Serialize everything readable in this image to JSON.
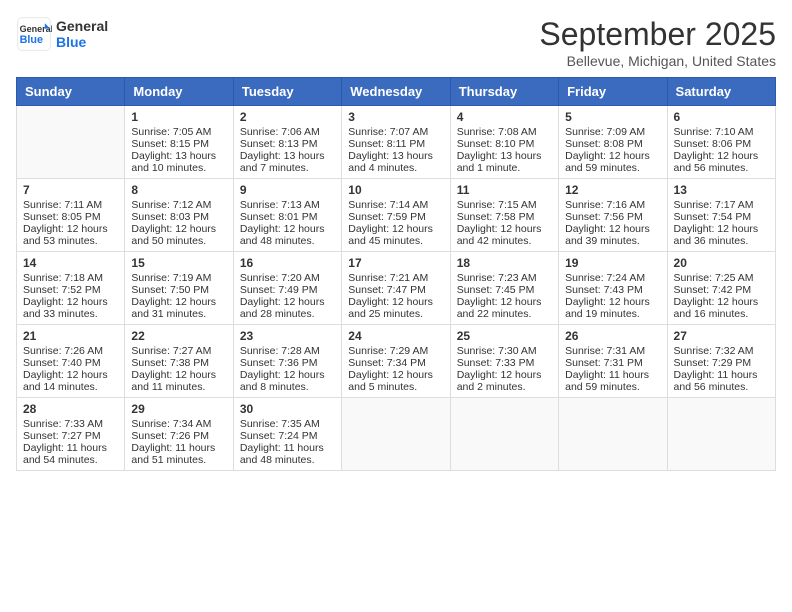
{
  "logo": {
    "line1": "General",
    "line2": "Blue"
  },
  "title": "September 2025",
  "subtitle": "Bellevue, Michigan, United States",
  "weekdays": [
    "Sunday",
    "Monday",
    "Tuesday",
    "Wednesday",
    "Thursday",
    "Friday",
    "Saturday"
  ],
  "weeks": [
    [
      {
        "day": "",
        "lines": []
      },
      {
        "day": "1",
        "lines": [
          "Sunrise: 7:05 AM",
          "Sunset: 8:15 PM",
          "Daylight: 13 hours",
          "and 10 minutes."
        ]
      },
      {
        "day": "2",
        "lines": [
          "Sunrise: 7:06 AM",
          "Sunset: 8:13 PM",
          "Daylight: 13 hours",
          "and 7 minutes."
        ]
      },
      {
        "day": "3",
        "lines": [
          "Sunrise: 7:07 AM",
          "Sunset: 8:11 PM",
          "Daylight: 13 hours",
          "and 4 minutes."
        ]
      },
      {
        "day": "4",
        "lines": [
          "Sunrise: 7:08 AM",
          "Sunset: 8:10 PM",
          "Daylight: 13 hours",
          "and 1 minute."
        ]
      },
      {
        "day": "5",
        "lines": [
          "Sunrise: 7:09 AM",
          "Sunset: 8:08 PM",
          "Daylight: 12 hours",
          "and 59 minutes."
        ]
      },
      {
        "day": "6",
        "lines": [
          "Sunrise: 7:10 AM",
          "Sunset: 8:06 PM",
          "Daylight: 12 hours",
          "and 56 minutes."
        ]
      }
    ],
    [
      {
        "day": "7",
        "lines": [
          "Sunrise: 7:11 AM",
          "Sunset: 8:05 PM",
          "Daylight: 12 hours",
          "and 53 minutes."
        ]
      },
      {
        "day": "8",
        "lines": [
          "Sunrise: 7:12 AM",
          "Sunset: 8:03 PM",
          "Daylight: 12 hours",
          "and 50 minutes."
        ]
      },
      {
        "day": "9",
        "lines": [
          "Sunrise: 7:13 AM",
          "Sunset: 8:01 PM",
          "Daylight: 12 hours",
          "and 48 minutes."
        ]
      },
      {
        "day": "10",
        "lines": [
          "Sunrise: 7:14 AM",
          "Sunset: 7:59 PM",
          "Daylight: 12 hours",
          "and 45 minutes."
        ]
      },
      {
        "day": "11",
        "lines": [
          "Sunrise: 7:15 AM",
          "Sunset: 7:58 PM",
          "Daylight: 12 hours",
          "and 42 minutes."
        ]
      },
      {
        "day": "12",
        "lines": [
          "Sunrise: 7:16 AM",
          "Sunset: 7:56 PM",
          "Daylight: 12 hours",
          "and 39 minutes."
        ]
      },
      {
        "day": "13",
        "lines": [
          "Sunrise: 7:17 AM",
          "Sunset: 7:54 PM",
          "Daylight: 12 hours",
          "and 36 minutes."
        ]
      }
    ],
    [
      {
        "day": "14",
        "lines": [
          "Sunrise: 7:18 AM",
          "Sunset: 7:52 PM",
          "Daylight: 12 hours",
          "and 33 minutes."
        ]
      },
      {
        "day": "15",
        "lines": [
          "Sunrise: 7:19 AM",
          "Sunset: 7:50 PM",
          "Daylight: 12 hours",
          "and 31 minutes."
        ]
      },
      {
        "day": "16",
        "lines": [
          "Sunrise: 7:20 AM",
          "Sunset: 7:49 PM",
          "Daylight: 12 hours",
          "and 28 minutes."
        ]
      },
      {
        "day": "17",
        "lines": [
          "Sunrise: 7:21 AM",
          "Sunset: 7:47 PM",
          "Daylight: 12 hours",
          "and 25 minutes."
        ]
      },
      {
        "day": "18",
        "lines": [
          "Sunrise: 7:23 AM",
          "Sunset: 7:45 PM",
          "Daylight: 12 hours",
          "and 22 minutes."
        ]
      },
      {
        "day": "19",
        "lines": [
          "Sunrise: 7:24 AM",
          "Sunset: 7:43 PM",
          "Daylight: 12 hours",
          "and 19 minutes."
        ]
      },
      {
        "day": "20",
        "lines": [
          "Sunrise: 7:25 AM",
          "Sunset: 7:42 PM",
          "Daylight: 12 hours",
          "and 16 minutes."
        ]
      }
    ],
    [
      {
        "day": "21",
        "lines": [
          "Sunrise: 7:26 AM",
          "Sunset: 7:40 PM",
          "Daylight: 12 hours",
          "and 14 minutes."
        ]
      },
      {
        "day": "22",
        "lines": [
          "Sunrise: 7:27 AM",
          "Sunset: 7:38 PM",
          "Daylight: 12 hours",
          "and 11 minutes."
        ]
      },
      {
        "day": "23",
        "lines": [
          "Sunrise: 7:28 AM",
          "Sunset: 7:36 PM",
          "Daylight: 12 hours",
          "and 8 minutes."
        ]
      },
      {
        "day": "24",
        "lines": [
          "Sunrise: 7:29 AM",
          "Sunset: 7:34 PM",
          "Daylight: 12 hours",
          "and 5 minutes."
        ]
      },
      {
        "day": "25",
        "lines": [
          "Sunrise: 7:30 AM",
          "Sunset: 7:33 PM",
          "Daylight: 12 hours",
          "and 2 minutes."
        ]
      },
      {
        "day": "26",
        "lines": [
          "Sunrise: 7:31 AM",
          "Sunset: 7:31 PM",
          "Daylight: 11 hours",
          "and 59 minutes."
        ]
      },
      {
        "day": "27",
        "lines": [
          "Sunrise: 7:32 AM",
          "Sunset: 7:29 PM",
          "Daylight: 11 hours",
          "and 56 minutes."
        ]
      }
    ],
    [
      {
        "day": "28",
        "lines": [
          "Sunrise: 7:33 AM",
          "Sunset: 7:27 PM",
          "Daylight: 11 hours",
          "and 54 minutes."
        ]
      },
      {
        "day": "29",
        "lines": [
          "Sunrise: 7:34 AM",
          "Sunset: 7:26 PM",
          "Daylight: 11 hours",
          "and 51 minutes."
        ]
      },
      {
        "day": "30",
        "lines": [
          "Sunrise: 7:35 AM",
          "Sunset: 7:24 PM",
          "Daylight: 11 hours",
          "and 48 minutes."
        ]
      },
      {
        "day": "",
        "lines": []
      },
      {
        "day": "",
        "lines": []
      },
      {
        "day": "",
        "lines": []
      },
      {
        "day": "",
        "lines": []
      }
    ]
  ]
}
